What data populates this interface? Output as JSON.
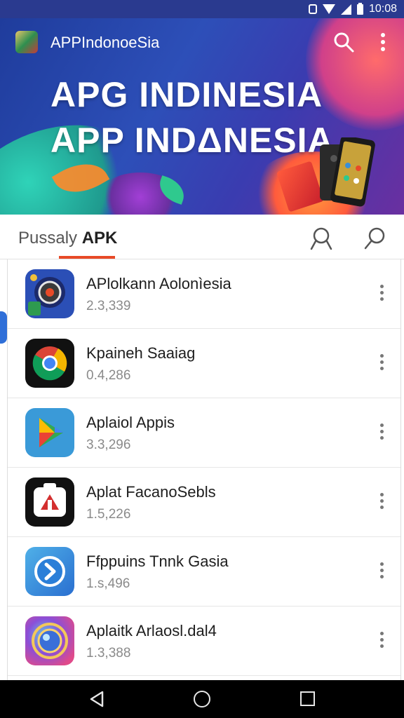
{
  "status_bar": {
    "time": "10:08"
  },
  "header": {
    "app_name": "APPIndonoeSia",
    "hero_line1": "APG INDINESIA",
    "hero_line2": "APP INDΔNESIA"
  },
  "tabs": {
    "label_prefix": "Pussaly",
    "label_bold": "APK"
  },
  "apps": [
    {
      "title": "APlolkann Aolonìesia",
      "version": "2.3,339",
      "icon": "camera-lens-icon"
    },
    {
      "title": "Kpaineh Saaiag",
      "version": "0.4,286",
      "icon": "chrome-icon"
    },
    {
      "title": "Aplaiol Appis",
      "version": "3.3,296",
      "icon": "play-store-icon"
    },
    {
      "title": "Aplat FacanoSebls",
      "version": "1.5,226",
      "icon": "camera-badge-icon"
    },
    {
      "title": "Ffppuins Tnnk Gasia",
      "version": "1.s,496",
      "icon": "play-circle-icon"
    },
    {
      "title": "Aplaitk Arlaosl.dal4",
      "version": "1.3,388",
      "icon": "lens-ring-icon"
    }
  ],
  "colors": {
    "status_bar": "#2a3a8f",
    "tab_underline": "#e84a27",
    "nav_bar": "#000000"
  }
}
